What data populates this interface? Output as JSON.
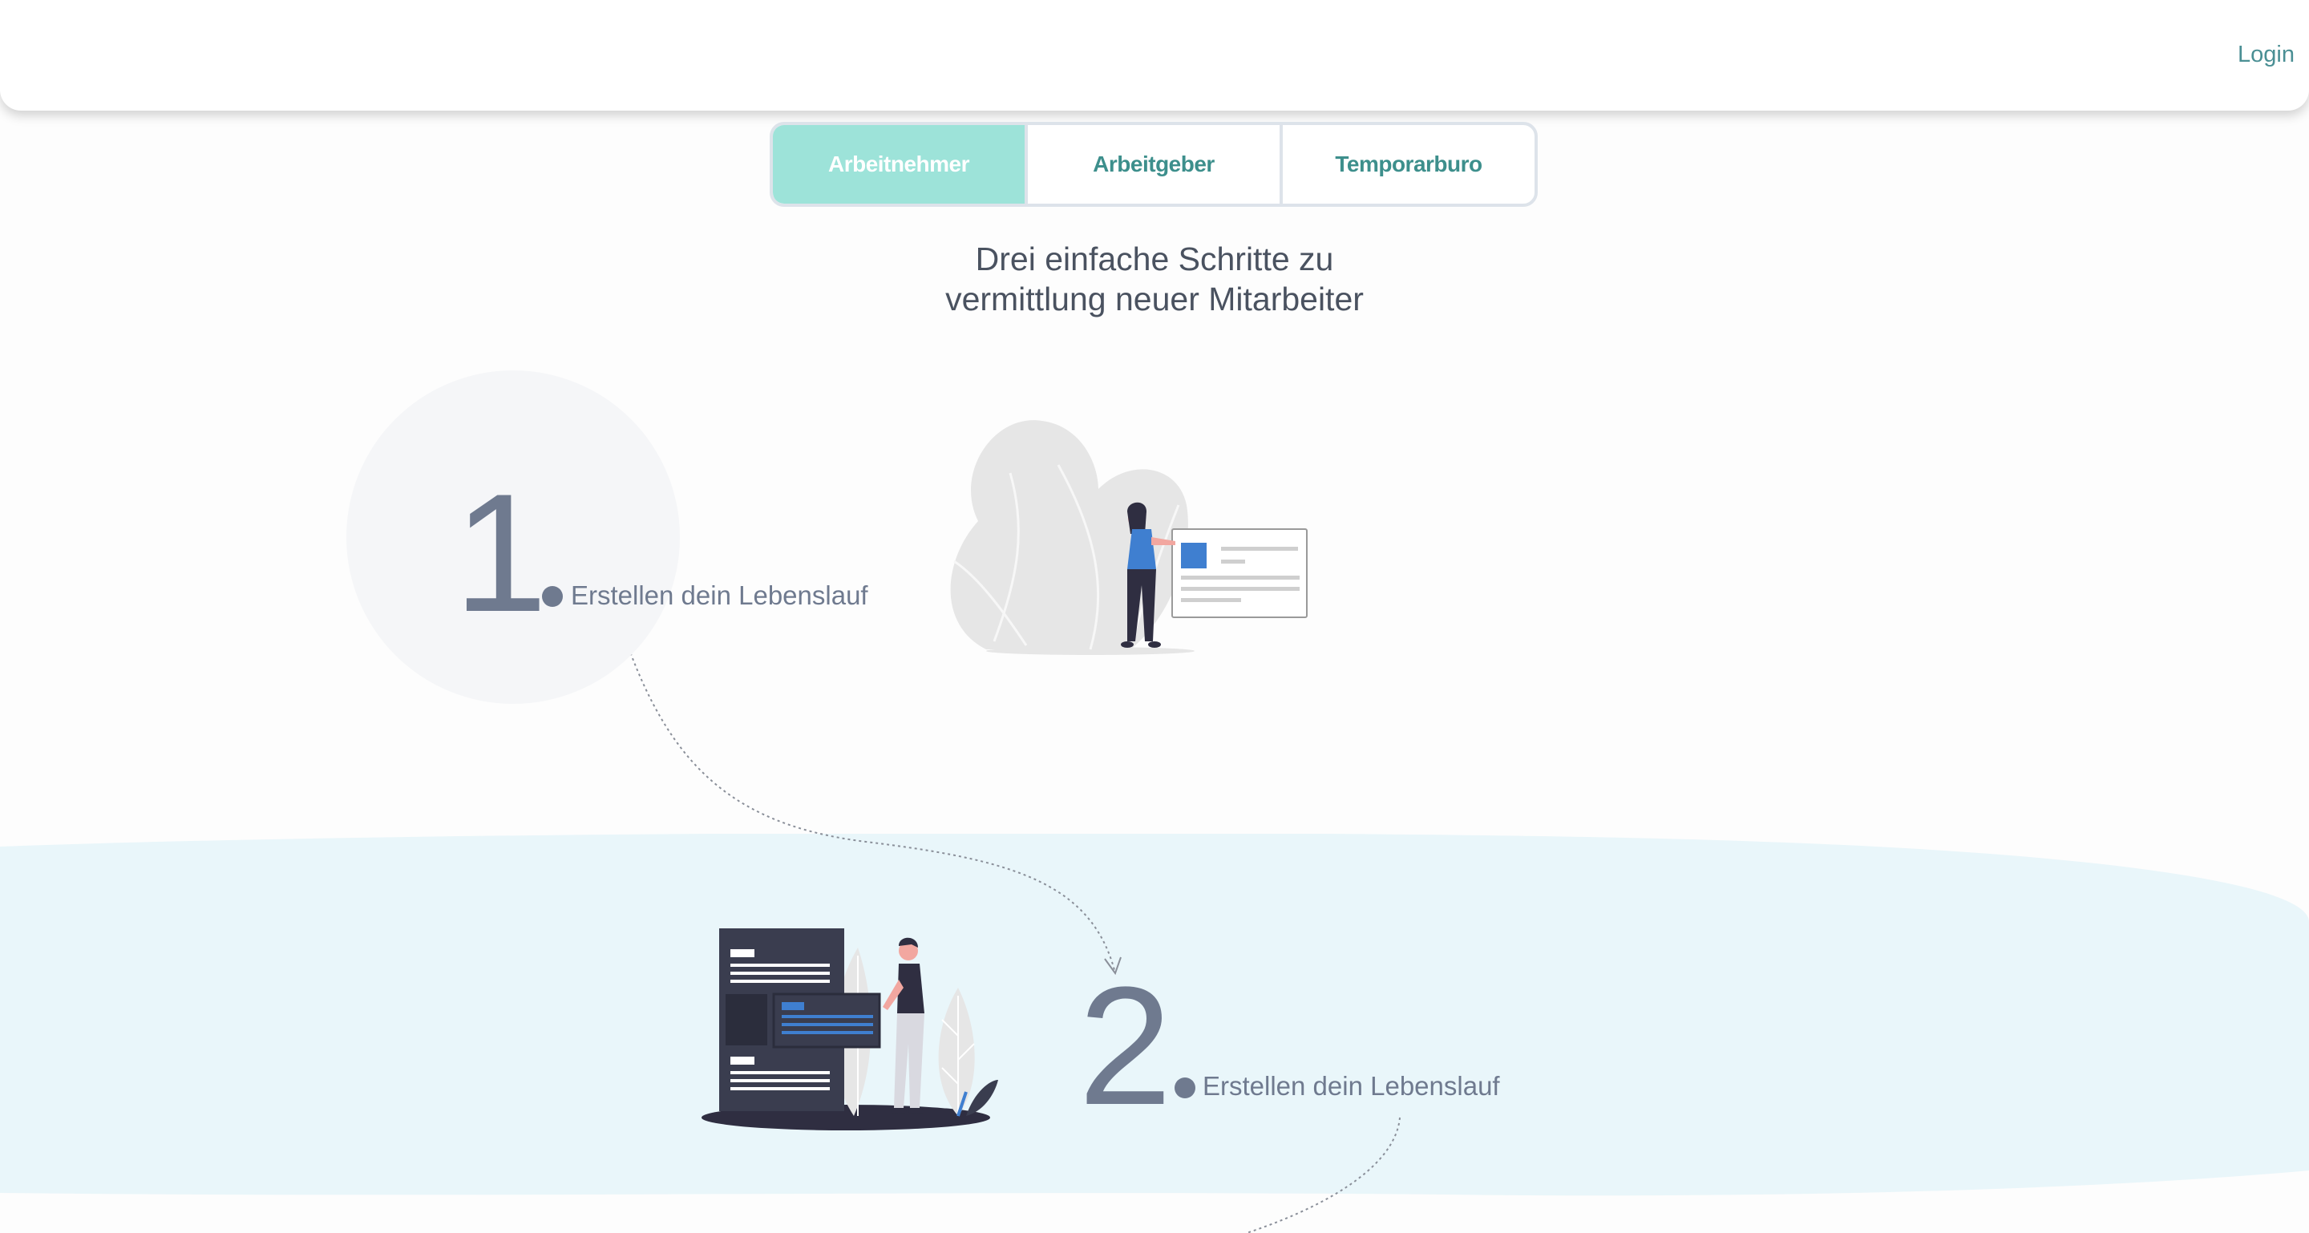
{
  "header": {
    "login_label": "Login"
  },
  "tabs": [
    {
      "label": "Arbeitnehmer",
      "active": true
    },
    {
      "label": "Arbeitgeber",
      "active": false
    },
    {
      "label": "Temporarburo",
      "active": false
    }
  ],
  "headline": {
    "line1": "Drei einfache Schritte zu",
    "line2": "vermittlung neuer Mitarbeiter"
  },
  "steps": [
    {
      "number": "1",
      "label": "Erstellen dein Lebenslauf"
    },
    {
      "number": "2",
      "label": "Erstellen dein Lebenslauf"
    }
  ],
  "colors": {
    "accent_tab": "#9de3d9",
    "tab_text": "#3d8f8c",
    "band": "#e9f6fa",
    "step_gray": "#6f7a8f",
    "illustration_blue": "#3f7fd0",
    "illustration_dark": "#3a3d4f"
  }
}
